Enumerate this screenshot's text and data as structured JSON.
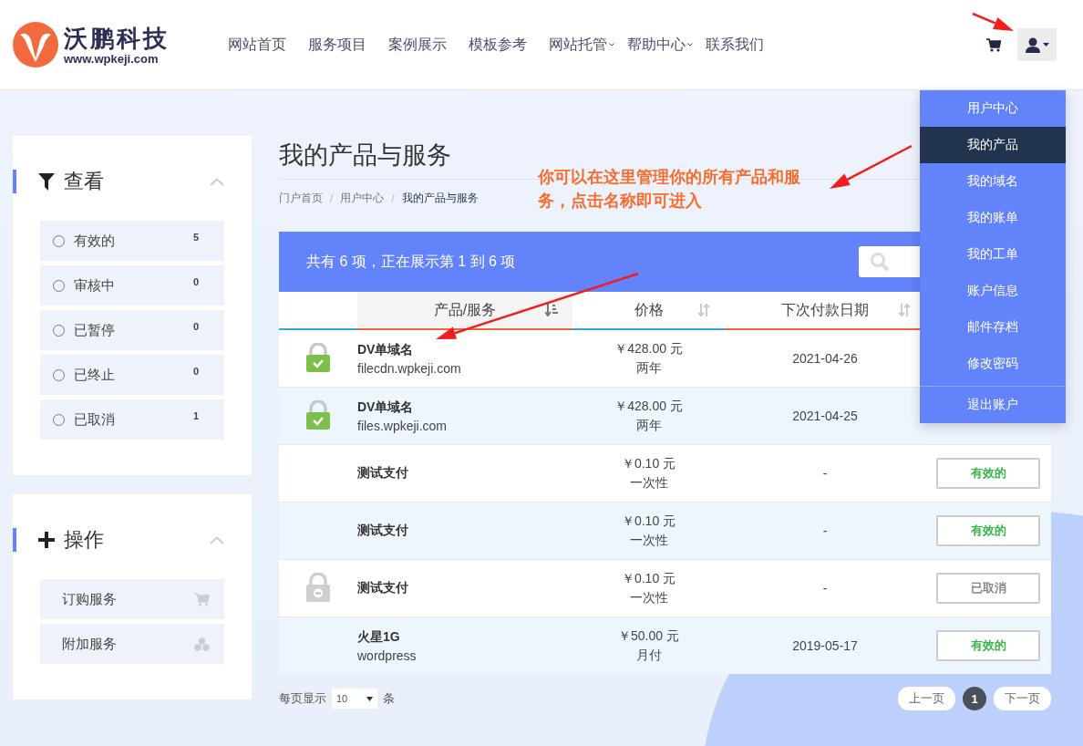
{
  "header": {
    "logo": {
      "name": "沃鹏科技",
      "url": "www.wpkeji.com"
    },
    "nav": [
      {
        "label": "网站首页",
        "has_dropdown": false
      },
      {
        "label": "服务项目",
        "has_dropdown": false
      },
      {
        "label": "案例展示",
        "has_dropdown": false
      },
      {
        "label": "模板参考",
        "has_dropdown": false
      },
      {
        "label": "网站托管",
        "has_dropdown": true
      },
      {
        "label": "帮助中心",
        "has_dropdown": true
      },
      {
        "label": "联系我们",
        "has_dropdown": false
      }
    ]
  },
  "user_menu": {
    "items": [
      {
        "label": "用户中心",
        "selected": false
      },
      {
        "label": "我的产品",
        "selected": true
      },
      {
        "label": "我的域名",
        "selected": false
      },
      {
        "label": "我的账单",
        "selected": false
      },
      {
        "label": "我的工单",
        "selected": false
      },
      {
        "label": "账户信息",
        "selected": false
      },
      {
        "label": "邮件存档",
        "selected": false
      },
      {
        "label": "修改密码",
        "selected": false
      }
    ],
    "logout": "退出账户"
  },
  "sidebar": {
    "view": {
      "title": "查看",
      "items": [
        {
          "label": "有效的",
          "count": "5",
          "selected": false
        },
        {
          "label": "审核中",
          "count": "0",
          "selected": false
        },
        {
          "label": "已暂停",
          "count": "0",
          "selected": false
        },
        {
          "label": "已终止",
          "count": "0",
          "selected": false
        },
        {
          "label": "已取消",
          "count": "1",
          "selected": false
        }
      ]
    },
    "actions": {
      "title": "操作",
      "items": [
        {
          "label": "订购服务",
          "kind": "cart"
        },
        {
          "label": "附加服务",
          "kind": "addons"
        }
      ]
    }
  },
  "main": {
    "title": "我的产品与服务",
    "breadcrumb": {
      "items": [
        "门户首页",
        "用户中心",
        "我的产品与服务"
      ],
      "separators": [
        "/",
        "/"
      ]
    },
    "table": {
      "summary": "共有 6 项，正在展示第 1 到 6 项",
      "columns": [
        {
          "label": "产品/服务",
          "sorted": true
        },
        {
          "label": "价格",
          "sorted": false
        },
        {
          "label": "下次付款日期",
          "sorted": false
        }
      ],
      "rows": [
        {
          "kind": "ssl",
          "name": "DV单域名",
          "domain": "filecdn.wpkeji.com",
          "price": "￥428.00 元",
          "cycle": "两年",
          "due": "2021-04-26"
        },
        {
          "kind": "ssl",
          "name": "DV单域名",
          "domain": "files.wpkeji.com",
          "price": "￥428.00 元",
          "cycle": "两年",
          "due": "2021-04-25"
        },
        {
          "kind": "plain",
          "name": "测试支付",
          "price": "￥0.10 元",
          "cycle": "一次性",
          "due": "-",
          "status": {
            "label": "有效的",
            "kind": "active"
          }
        },
        {
          "kind": "plain",
          "name": "测试支付",
          "price": "￥0.10 元",
          "cycle": "一次性",
          "due": "-",
          "status": {
            "label": "有效的",
            "kind": "active"
          }
        },
        {
          "kind": "cancelled",
          "name": "测试支付",
          "price": "￥0.10 元",
          "cycle": "一次性",
          "due": "-",
          "status": {
            "label": "已取消",
            "kind": "cancelled"
          }
        },
        {
          "kind": "plain",
          "name": "火星1G",
          "domain": "wordpress",
          "price": "￥50.00 元",
          "cycle": "月付",
          "due": "2019-05-17",
          "status": {
            "label": "有效的",
            "kind": "active"
          }
        }
      ]
    },
    "pagination": {
      "per_page_label": "每页显示",
      "per_page": "10",
      "unit": "条",
      "prev": "上一页",
      "pages": [
        {
          "label": "1",
          "selected": true
        }
      ],
      "next": "下一页"
    }
  },
  "annotation": {
    "text": "你可以在这里管理你的所有产品和服务，点击名称即可进入"
  }
}
